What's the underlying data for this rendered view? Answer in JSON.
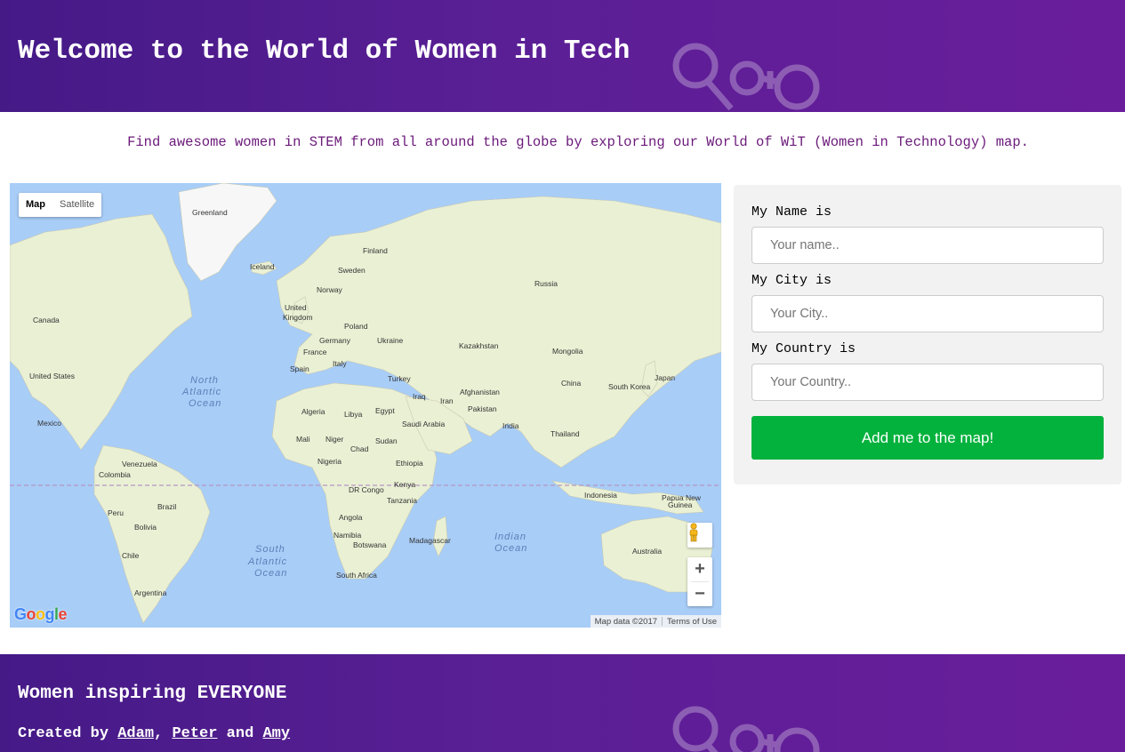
{
  "header": {
    "title": "Welcome to the World of Women in Tech",
    "logo_icon": "venus-symbols-icon"
  },
  "tagline": "Find awesome women in STEM from all around the globe by exploring our World of WiT (Women in Technology) map.",
  "map": {
    "type_buttons": [
      "Map",
      "Satellite"
    ],
    "active_type": "Map",
    "labels": {
      "greenland": "Greenland",
      "iceland": "Iceland",
      "finland": "Finland",
      "sweden": "Sweden",
      "norway": "Norway",
      "russia": "Russia",
      "uk1": "United",
      "uk2": "Kingdom",
      "poland": "Poland",
      "germany": "Germany",
      "ukraine": "Ukraine",
      "kazakhstan": "Kazakhstan",
      "mongolia": "Mongolia",
      "france": "France",
      "italy": "Italy",
      "spain": "Spain",
      "turkey": "Turkey",
      "canada": "Canada",
      "us": "United States",
      "mexico": "Mexico",
      "iraq": "Iraq",
      "iran": "Iran",
      "afghanistan": "Afghanistan",
      "pakistan": "Pakistan",
      "china": "China",
      "south_korea": "South Korea",
      "japan": "Japan",
      "algeria": "Algeria",
      "libya": "Libya",
      "egypt": "Egypt",
      "saudi": "Saudi Arabia",
      "india": "India",
      "thailand": "Thailand",
      "mali": "Mali",
      "niger": "Niger",
      "chad": "Chad",
      "sudan": "Sudan",
      "nigeria": "Nigeria",
      "ethiopia": "Ethiopia",
      "venezuela": "Venezuela",
      "colombia": "Colombia",
      "kenya": "Kenya",
      "dr_congo": "DR Congo",
      "tanzania": "Tanzania",
      "indonesia": "Indonesia",
      "png1": "Papua New",
      "png2": "Guinea",
      "peru": "Peru",
      "brazil": "Brazil",
      "bolivia": "Bolivia",
      "angola": "Angola",
      "namibia": "Namibia",
      "botswana": "Botswana",
      "madagascar": "Madagascar",
      "chile": "Chile",
      "australia": "Australia",
      "south_africa": "South Africa",
      "argentina": "Argentina",
      "n_atlantic_1": "North",
      "n_atlantic_2": "Atlantic",
      "n_atlantic_3": "Ocean",
      "s_atlantic_1": "South",
      "s_atlantic_2": "Atlantic",
      "s_atlantic_3": "Ocean",
      "indian_1": "Indian",
      "indian_2": "Ocean"
    },
    "zoom_in": "+",
    "zoom_out": "−",
    "google": "Google",
    "attribution": "Map data ©2017",
    "terms": "Terms of Use",
    "pegman_icon": "street-view-pegman-icon"
  },
  "form": {
    "name_label": "My Name is",
    "name_placeholder": "Your name..",
    "city_label": "My City is",
    "city_placeholder": "Your City..",
    "country_label": "My Country is",
    "country_placeholder": "Your Country..",
    "submit_label": "Add me to the map!"
  },
  "footer": {
    "heading": "Women inspiring EVERYONE",
    "credit_prefix": "Created by",
    "authors": [
      "Adam",
      "Peter",
      "Amy"
    ],
    "sep1": ",",
    "sep2": "and"
  },
  "colors": {
    "header_start": "#451a87",
    "header_end": "#6a1d9b",
    "tagline": "#6b1a7a",
    "submit": "#02b23c",
    "panel": "#f2f2f2",
    "ocean": "#a8cdf7",
    "land": "#eaf0d4"
  }
}
